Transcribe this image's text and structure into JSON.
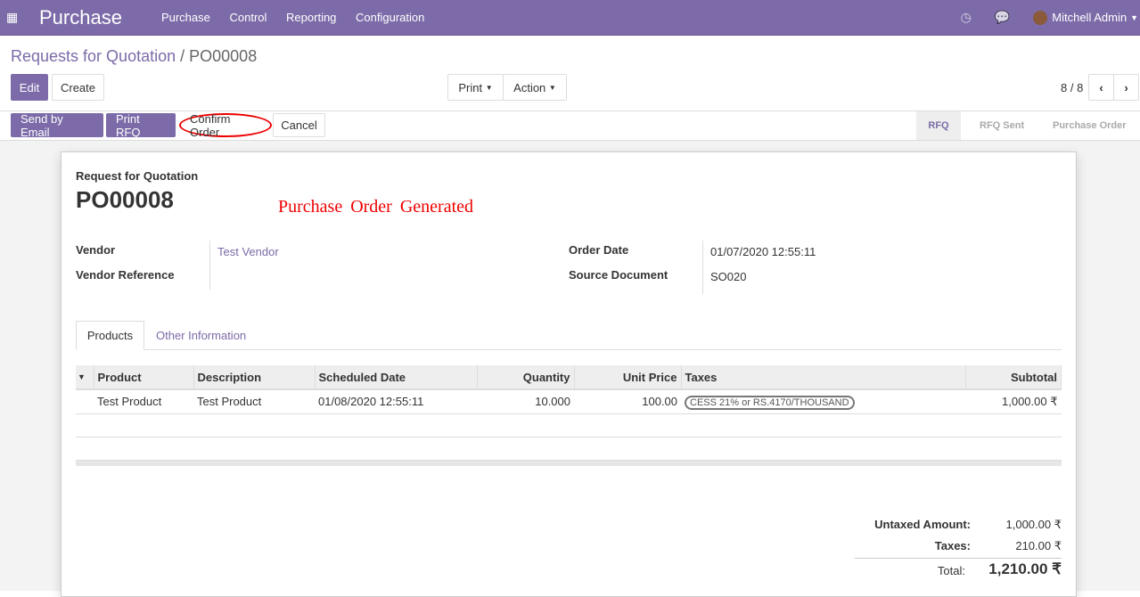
{
  "nav": {
    "app_title": "Purchase",
    "menu": [
      "Purchase",
      "Control",
      "Reporting",
      "Configuration"
    ],
    "user": "Mitchell Admin"
  },
  "breadcrumb": {
    "parent": "Requests for Quotation",
    "current": "PO00008"
  },
  "toolbar": {
    "edit": "Edit",
    "create": "Create",
    "print": "Print",
    "action": "Action",
    "pager": "8 / 8"
  },
  "actions": {
    "send_email": "Send by Email",
    "print_rfq": "Print RFQ",
    "confirm": "Confirm Order",
    "cancel": "Cancel"
  },
  "stages": [
    {
      "label": "RFQ",
      "active": true
    },
    {
      "label": "RFQ Sent",
      "active": false
    },
    {
      "label": "Purchase Order",
      "active": false
    }
  ],
  "form": {
    "subtitle": "Request for Quotation",
    "name": "PO00008",
    "annotation": "Purchase Order Generated",
    "vendor_label": "Vendor",
    "vendor": "Test Vendor",
    "vendor_ref_label": "Vendor Reference",
    "vendor_ref": "",
    "order_date_label": "Order Date",
    "order_date": "01/07/2020 12:55:11",
    "source_label": "Source Document",
    "source": "SO020"
  },
  "tabs": [
    "Products",
    "Other Information"
  ],
  "table": {
    "headers": [
      "Product",
      "Description",
      "Scheduled Date",
      "Quantity",
      "Unit Price",
      "Taxes",
      "Subtotal"
    ],
    "rows": [
      [
        "Test Product",
        "Test Product",
        "01/08/2020 12:55:11",
        "10.000",
        "100.00",
        "CESS 21% or RS.4170/THOUSAND",
        "1,000.00 ₹"
      ]
    ]
  },
  "totals": {
    "untaxed_label": "Untaxed Amount:",
    "untaxed": "1,000.00 ₹",
    "taxes_label": "Taxes:",
    "taxes": "210.00 ₹",
    "total_label": "Total:",
    "total": "1,210.00 ₹"
  },
  "colors": {
    "brand": "#7c6ba8",
    "annotation": "#e00000"
  }
}
